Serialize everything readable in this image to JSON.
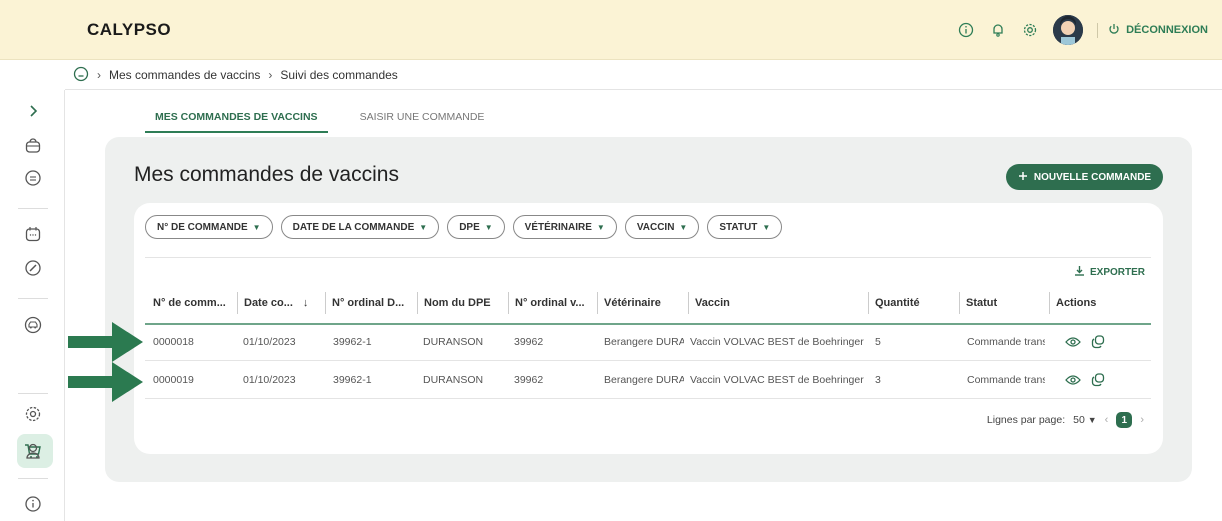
{
  "app": {
    "logo": "CALYPSO"
  },
  "header": {
    "logout_label": "DÉCONNEXION"
  },
  "breadcrumb": {
    "items": [
      "Mes commandes de vaccins",
      "Suivi des commandes"
    ]
  },
  "tabs": [
    {
      "label": "MES COMMANDES DE VACCINS",
      "active": true
    },
    {
      "label": "SAISIR UNE COMMANDE",
      "active": false
    }
  ],
  "main": {
    "title": "Mes commandes de vaccins",
    "new_button_label": "NOUVELLE COMMANDE",
    "export_label": "EXPORTER"
  },
  "filters": [
    "N° DE COMMANDE",
    "DATE DE LA COMMANDE",
    "DPE",
    "VÉTÉRINAIRE",
    "VACCIN",
    "STATUT"
  ],
  "table": {
    "columns": [
      "N° de comm...",
      "Date co...",
      "N° ordinal D...",
      "Nom du DPE",
      "N° ordinal v...",
      "Vétérinaire",
      "Vaccin",
      "Quantité",
      "Statut",
      "Actions"
    ],
    "rows": [
      [
        "0000018",
        "01/10/2023",
        "39962-1",
        "DURANSON",
        "39962",
        "Berangere DURA",
        "Vaccin VOLVAC BEST de Boehringer",
        "5",
        "Commande trans"
      ],
      [
        "0000019",
        "01/10/2023",
        "39962-1",
        "DURANSON",
        "39962",
        "Berangere DURA",
        "Vaccin VOLVAC BEST de Boehringer",
        "3",
        "Commande trans"
      ]
    ]
  },
  "pagination": {
    "label": "Lignes par page:",
    "per_page": "50",
    "current_page": "1"
  },
  "icons": {
    "top": [
      "info-icon",
      "bell-icon",
      "gear-icon",
      "avatar",
      "power-icon"
    ],
    "sidebar": [
      "chevron-right-icon",
      "bag-icon",
      "document-icon",
      "calendar-icon",
      "pen-icon",
      "vehicle-icon",
      "cart-icon",
      "gear-icon",
      "user-icon",
      "info-icon"
    ],
    "actions": [
      "eye-icon",
      "copy-icon"
    ]
  },
  "colors": {
    "accent": "#2e6e4f",
    "topbar": "#fbf3d5",
    "active_sidebar": "#dcefe4",
    "arrow": "#2b7a50"
  }
}
